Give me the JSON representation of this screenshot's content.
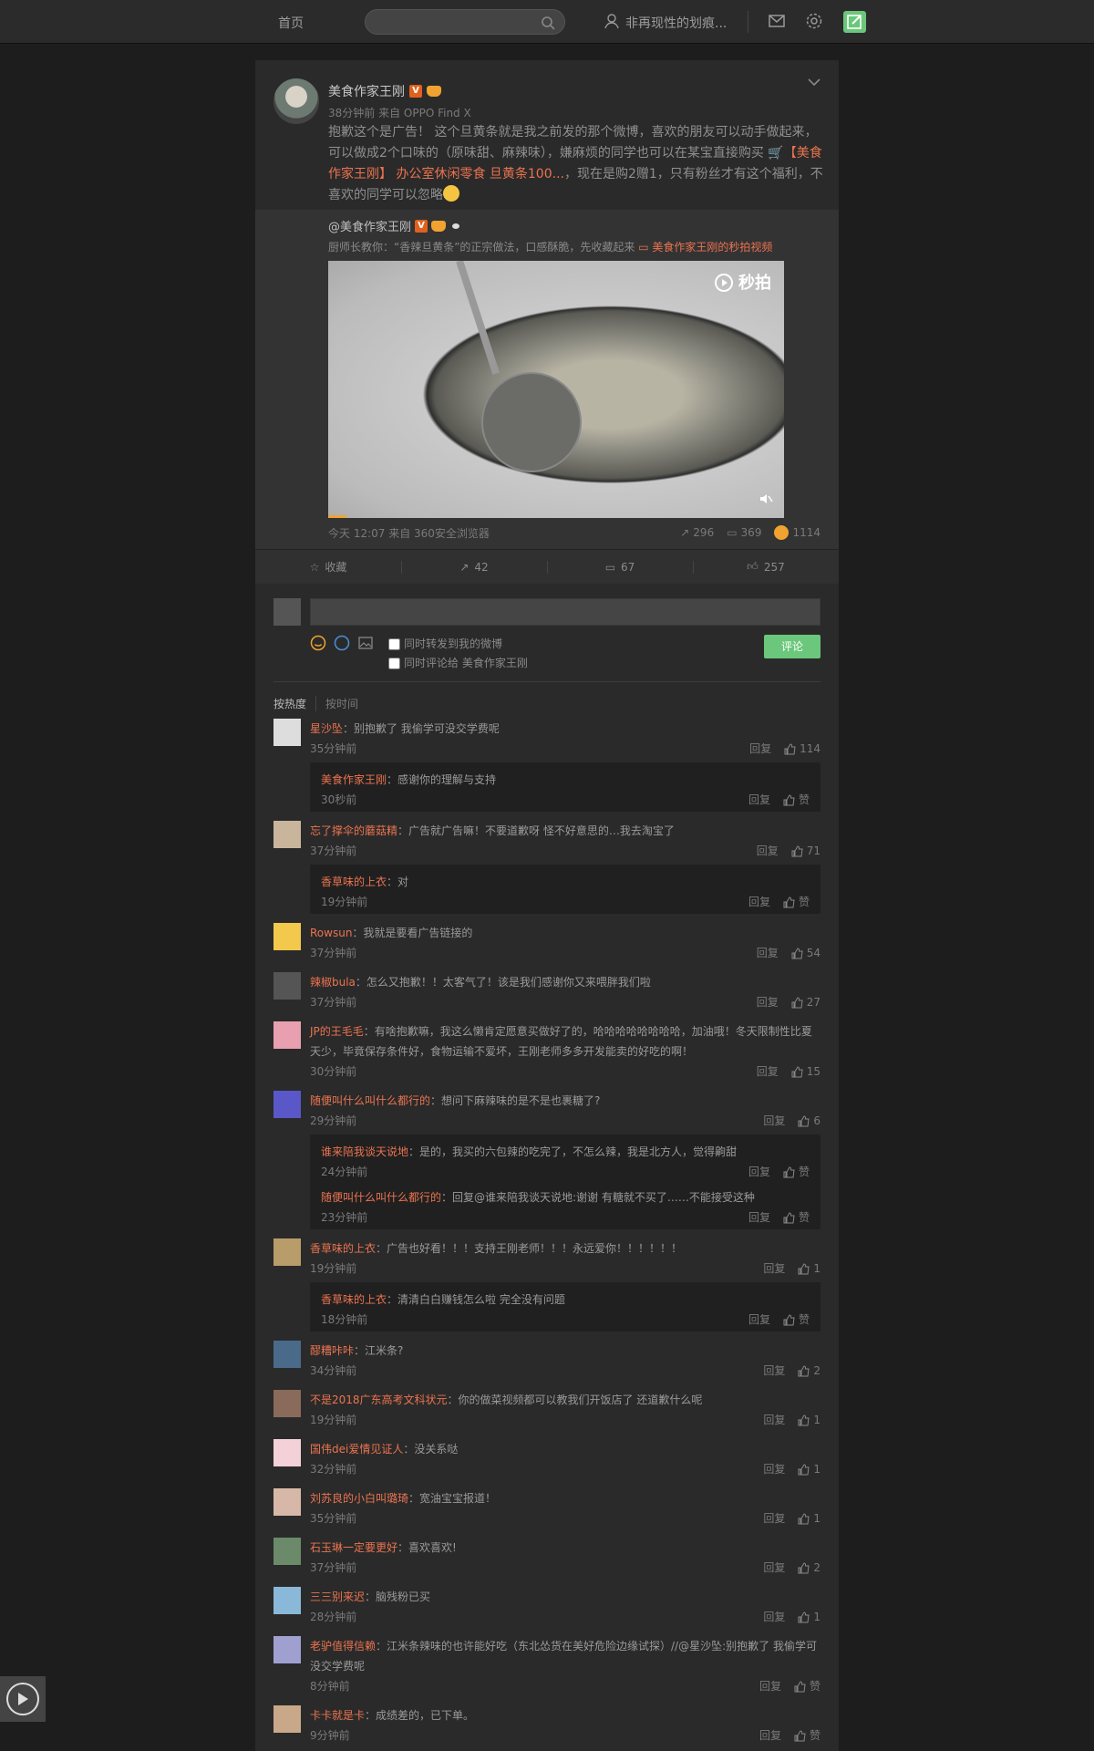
{
  "topbar": {
    "home": "首页",
    "search_placeholder": "",
    "username": "非再现性的划痕..."
  },
  "post": {
    "author": "美食作家王刚",
    "meta": "38分钟前 来自 OPPO Find X",
    "text_1": "抱歉这个是广告！ 这个旦黄条就是我之前发的那个微博，喜欢的朋友可以动手做起来，可以做成2个口味的（原味甜、麻辣味），嫌麻烦的同学也可以在某宝直接购买 ",
    "link_text": "🛒【美食作家王刚】 办公室休闲零食 旦黄条100...",
    "text_2": "，现在是购2赠1，只有粉丝才有这个福利，不喜欢的同学可以忽略"
  },
  "repost": {
    "author": "@美食作家王刚",
    "text": "厨师长教你：“香辣旦黄条”的正宗做法，口感酥脆，先收藏起来 ",
    "video_link": "美食作家王刚的秒拍视频",
    "video_brand": "秒拍",
    "meta": "今天 12:07 来自 360安全浏览器",
    "reposts": "296",
    "comments": "369",
    "likes": "1114"
  },
  "actions": {
    "favorite": "收藏",
    "repost": "42",
    "comment": "67",
    "like": "257"
  },
  "comment_box": {
    "opt1": "同时转发到我的微博",
    "opt2": "同时评论给 美食作家王刚",
    "submit": "评论"
  },
  "sort": {
    "hot": "按热度",
    "time": "按时间"
  },
  "labels": {
    "reply": "回复",
    "like": "赞"
  },
  "comments": [
    {
      "name": "星沙坠",
      "text": "：别抱歉了  我偷学可没交学费呢",
      "time": "35分钟前",
      "likes": "114",
      "replies": [
        {
          "name": "美食作家王刚",
          "text": "：感谢你的理解与支持",
          "time": "30秒前"
        }
      ]
    },
    {
      "name": "忘了撑伞的蘑菇精",
      "text": "：广告就广告嘛！不要道歉呀 怪不好意思的…我去淘宝了",
      "time": "37分钟前",
      "likes": "71",
      "replies": [
        {
          "name": "香草味的上衣",
          "text": "：对",
          "time": "19分钟前"
        }
      ]
    },
    {
      "name": "Rowsun",
      "text": "：我就是要看广告链接的",
      "time": "37分钟前",
      "likes": "54"
    },
    {
      "name": "辣椒bula",
      "text": "：怎么又抱歉！！太客气了！该是我们感谢你又来喂胖我们啦",
      "time": "37分钟前",
      "likes": "27"
    },
    {
      "name": "JP的王毛毛",
      "text": "：有啥抱歉嘛，我这么懒肯定愿意买做好了的，哈哈哈哈哈哈哈哈，加油哦！冬天限制性比夏天少，毕竟保存条件好，食物运输不爱坏，王刚老师多多开发能卖的好吃的啊！",
      "time": "30分钟前",
      "likes": "15"
    },
    {
      "name": "随便叫什么叫什么都行的",
      "text": "：想问下麻辣味的是不是也裹糖了?",
      "time": "29分钟前",
      "likes": "6",
      "replies": [
        {
          "name": "谁来陪我谈天说地",
          "text": "：是的，我买的六包辣的吃完了，不怎么辣，我是北方人，觉得齁甜",
          "time": "24分钟前"
        },
        {
          "name": "随便叫什么叫什么都行的",
          "text": "：回复@谁来陪我谈天说地:谢谢 有糖就不买了……不能接受这种",
          "time": "23分钟前"
        }
      ]
    },
    {
      "name": "香草味的上衣",
      "text": "：广告也好看！！！支持王刚老师！！！永远爱你！！！！！！",
      "time": "19分钟前",
      "likes": "1",
      "replies": [
        {
          "name": "香草味的上衣",
          "text": "：清清白白赚钱怎么啦 完全没有问题",
          "time": "18分钟前"
        }
      ]
    },
    {
      "name": "醪糟咔咔",
      "text": "：江米条?",
      "time": "34分钟前",
      "likes": "2"
    },
    {
      "name": "不是2018广东高考文科状元",
      "text": "：你的做菜视频都可以教我们开饭店了 还道歉什么呢",
      "time": "19分钟前",
      "likes": "1"
    },
    {
      "name": "国伟dei爱情见证人",
      "text": "：没关系哒",
      "time": "32分钟前",
      "likes": "1"
    },
    {
      "name": "刘苏良的小白叫璐琦",
      "text": "：宽油宝宝报道！",
      "time": "35分钟前",
      "likes": "1"
    },
    {
      "name": "石玉琳一定要更好",
      "text": "：喜欢喜欢!",
      "time": "37分钟前",
      "likes": "2"
    },
    {
      "name": "三三别来迟",
      "text": "：脑残粉已买",
      "time": "28分钟前",
      "likes": "1"
    },
    {
      "name": "老驴值得信赖",
      "text": "：江米条辣味的也许能好吃（东北怂货在美好危险边缘试探）//@星沙坠:别抱歉了  我偷学可没交学费呢",
      "time": "8分钟前",
      "likes": "赞"
    },
    {
      "name": "卡卡就是卡",
      "text": "：成绩差的，已下单。",
      "time": "9分钟前",
      "likes": "赞"
    }
  ]
}
